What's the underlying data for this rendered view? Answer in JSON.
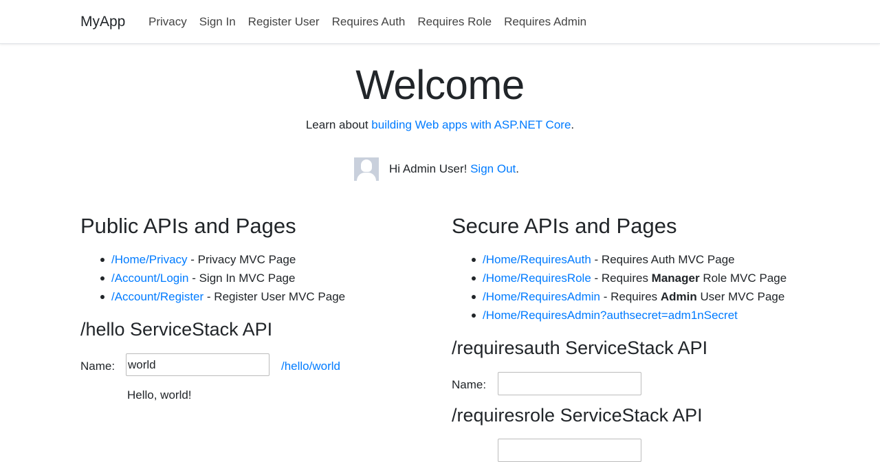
{
  "navbar": {
    "brand": "MyApp",
    "links": [
      "Privacy",
      "Sign In",
      "Register User",
      "Requires Auth",
      "Requires Role",
      "Requires Admin"
    ]
  },
  "hero": {
    "title": "Welcome",
    "sub_prefix": "Learn about ",
    "sub_link": "building Web apps with ASP.NET Core",
    "sub_suffix": "."
  },
  "user": {
    "greeting": "Hi Admin User! ",
    "signout": "Sign Out",
    "suffix": "."
  },
  "public": {
    "title": "Public APIs and Pages",
    "items": [
      {
        "link": "/Home/Privacy",
        "desc": " - Privacy MVC Page"
      },
      {
        "link": "/Account/Login",
        "desc": " - Sign In MVC Page"
      },
      {
        "link": "/Account/Register",
        "desc": " - Register User MVC Page"
      }
    ],
    "hello": {
      "title": "/hello ServiceStack API",
      "label": "Name:",
      "value": "world",
      "link": "/hello/world",
      "result": "Hello, world!"
    }
  },
  "secure": {
    "title": "Secure APIs and Pages",
    "items": [
      {
        "link": "/Home/RequiresAuth",
        "pre": " - Requires Auth MVC Page",
        "bold": "",
        "post": ""
      },
      {
        "link": "/Home/RequiresRole",
        "pre": " - Requires ",
        "bold": "Manager",
        "post": " Role MVC Page"
      },
      {
        "link": "/Home/RequiresAdmin",
        "pre": " - Requires ",
        "bold": "Admin",
        "post": " User MVC Page"
      },
      {
        "link": "/Home/RequiresAdmin?authsecret=adm1nSecret",
        "pre": "",
        "bold": "",
        "post": ""
      }
    ],
    "requiresauth": {
      "title": "/requiresauth ServiceStack API",
      "label": "Name:",
      "value": ""
    },
    "requiresrole": {
      "title": "/requiresrole ServiceStack API"
    }
  }
}
